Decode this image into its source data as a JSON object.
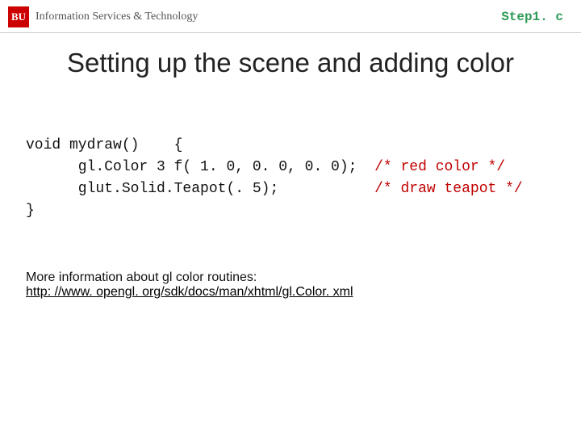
{
  "header": {
    "logo_text": "BU",
    "org_text": "Information Services & Technology",
    "filename": "Step1. c"
  },
  "slide": {
    "title": "Setting up the scene and adding color"
  },
  "code": {
    "line1": "void mydraw()    {",
    "line2a": "      gl.Color 3 f( 1. 0, 0. 0, 0. 0);  ",
    "line2b": "/* red color */",
    "line3a": "      glut.Solid.Teapot(. 5);           ",
    "line3b": "/* draw teapot */",
    "line4": "}"
  },
  "info": {
    "text": "More information about gl color routines:",
    "link_text": "http: //www. opengl. org/sdk/docs/man/xhtml/gl.Color. xml",
    "link_href": "http://www.opengl.org/sdk/docs/man/xhtml/glColor.xml"
  }
}
